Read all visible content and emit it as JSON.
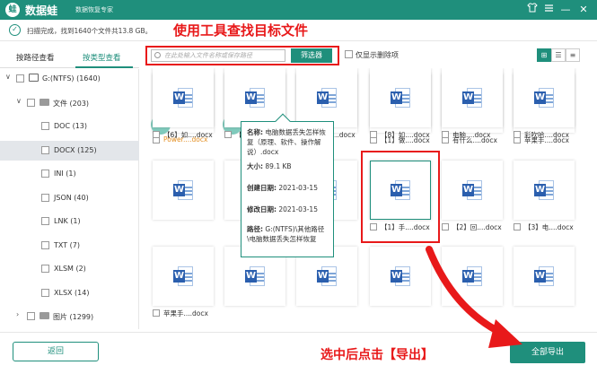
{
  "app": {
    "title": "数据蛙",
    "subtitle": "数据恢复专家",
    "logo": "蛙"
  },
  "window": {
    "skin_icon": "shirt-icon",
    "menu_icon": "menu-icon",
    "minimize": "—",
    "close": "✕"
  },
  "status": {
    "text": "扫描完成，找到1640个文件共13.8 GB。"
  },
  "annotations": {
    "top": "使用工具查找目标文件",
    "bottom": "选中后点击【导出】"
  },
  "side_tabs": [
    {
      "label": "按路径查看"
    },
    {
      "label": "按类型查看",
      "active": true
    }
  ],
  "tree": [
    {
      "label": "G:(NTFS) (1640)",
      "level": 0,
      "arrow": "∨",
      "icon": "disk-icon"
    },
    {
      "label": "文件 (203)",
      "level": 1,
      "arrow": "∨",
      "icon": "folder-icon"
    },
    {
      "label": "DOC (13)",
      "level": 2
    },
    {
      "label": "DOCX (125)",
      "level": 2,
      "selected": true
    },
    {
      "label": "INI (1)",
      "level": 2
    },
    {
      "label": "JSON (40)",
      "level": 2
    },
    {
      "label": "LNK (1)",
      "level": 2
    },
    {
      "label": "TXT (7)",
      "level": 2
    },
    {
      "label": "XLSM (2)",
      "level": 2
    },
    {
      "label": "XLSX (14)",
      "level": 2
    },
    {
      "label": "图片 (1299)",
      "level": 1,
      "arrow": "›",
      "icon": "folder-icon"
    }
  ],
  "toolbar": {
    "search_placeholder": "在此处输入文件名称或保存路径",
    "filter_label": "筛选器",
    "only_deleted_label": "仅显示删除项",
    "views": [
      "⊞",
      "☰",
      "≡"
    ]
  },
  "files": [
    {
      "name": "Power....docx",
      "orange": true,
      "deco": true
    },
    {
      "name": "",
      "deco": true,
      "hover": true
    },
    {
      "name": "",
      "hidden": true
    },
    {
      "name": "【1】做....docx"
    },
    {
      "name": "有什么....docx"
    },
    {
      "name": "苹果手....docx"
    },
    {
      "name": "",
      "hidden": true
    },
    {
      "name": "",
      "hidden": true
    },
    {
      "name": "",
      "hidden": true
    },
    {
      "name": "【1】手....docx",
      "highlight": true
    },
    {
      "name": "【2】回....docx"
    },
    {
      "name": "【3】电....docx"
    },
    {
      "name": "苹果手....docx"
    },
    {
      "name": "",
      "hidden": true
    },
    {
      "name": "",
      "hidden": true
    },
    {
      "name": "",
      "hidden": true
    },
    {
      "name": "",
      "hidden": true
    },
    {
      "name": "",
      "hidden": true
    },
    {
      "name": "【6】如....docx"
    },
    {
      "name": "【7】M....docx"
    },
    {
      "name": "【7】M....docx"
    },
    {
      "name": "【8】如....docx"
    },
    {
      "name": "电脑....docx"
    },
    {
      "name": "彩吹哈....docx"
    }
  ],
  "tooltip": {
    "name_label": "名称:",
    "name_value": "电脑数据丢失怎样恢复（原理、软件、操作解说）.docx",
    "size_label": "大小:",
    "size_value": "89.1 KB",
    "created_label": "创建日期:",
    "created_value": "2021-03-15",
    "modified_label": "修改日期:",
    "modified_value": "2021-03-15",
    "path_label": "路径:",
    "path_value": "G:(NTFS)\\其他路径\\电脑数据丢失怎样恢复"
  },
  "buttons": {
    "back": "返回",
    "export_all": "全部导出"
  },
  "colors": {
    "brand": "#1f8f7c",
    "annotation": "#e8191a",
    "word_blue": "#2b5fae"
  }
}
